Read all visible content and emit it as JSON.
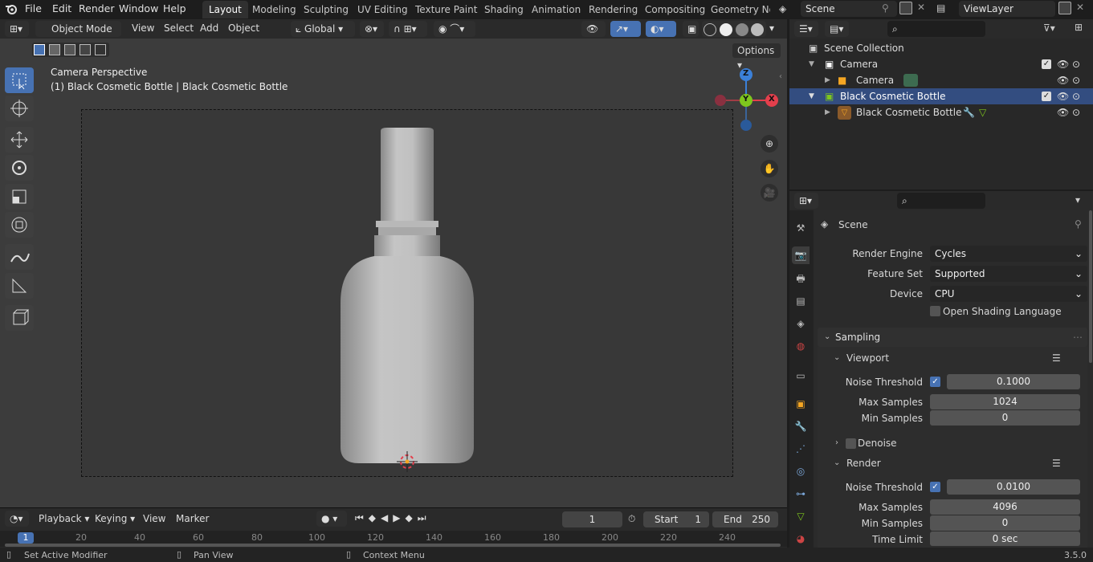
{
  "menus": [
    "File",
    "Edit",
    "Render",
    "Window",
    "Help"
  ],
  "workspaces": [
    "Layout",
    "Modeling",
    "Sculpting",
    "UV Editing",
    "Texture Paint",
    "Shading",
    "Animation",
    "Rendering",
    "Compositing",
    "Geometry Noc"
  ],
  "scene_field": "Scene",
  "viewlayer_field": "ViewLayer",
  "viewport_header": {
    "mode": "Object Mode",
    "menus": [
      "View",
      "Select",
      "Add",
      "Object"
    ],
    "orientation": "Global",
    "options": "Options"
  },
  "viewport": {
    "title": "Camera Perspective",
    "subtitle": "(1) Black Cosmetic Bottle | Black Cosmetic Bottle",
    "gizmo": {
      "z": "Z",
      "y": "Y",
      "x": "X"
    }
  },
  "timeline": {
    "menus": [
      "Playback",
      "Keying",
      "View",
      "Marker"
    ],
    "current_frame": "1",
    "start_label": "Start",
    "start_value": "1",
    "end_label": "End",
    "end_value": "250",
    "ruler": [
      "1",
      "20",
      "40",
      "60",
      "80",
      "100",
      "120",
      "140",
      "160",
      "180",
      "200",
      "220",
      "240"
    ]
  },
  "status": {
    "left": "Set Active Modifier",
    "middle": "Pan View",
    "right": "Context Menu",
    "version": "3.5.0"
  },
  "outliner": {
    "root": "Scene Collection",
    "rows": [
      {
        "label": "Camera",
        "type": "collection"
      },
      {
        "label": "Camera",
        "type": "object"
      },
      {
        "label": "Black Cosmetic Bottle",
        "type": "collection"
      },
      {
        "label": "Black Cosmetic Bottle",
        "type": "object"
      }
    ]
  },
  "properties": {
    "context": "Scene",
    "render_engine_label": "Render Engine",
    "render_engine": "Cycles",
    "feature_set_label": "Feature Set",
    "feature_set": "Supported",
    "device_label": "Device",
    "device": "CPU",
    "osl_label": "Open Shading Language",
    "sampling": "Sampling",
    "viewport_panel": "Viewport",
    "render_panel": "Render",
    "denoise_label": "Denoise",
    "vp_noise_label": "Noise Threshold",
    "vp_noise": "0.1000",
    "vp_max_label": "Max Samples",
    "vp_max": "1024",
    "vp_min_label": "Min Samples",
    "vp_min": "0",
    "r_noise_label": "Noise Threshold",
    "r_noise": "0.0100",
    "r_max_label": "Max Samples",
    "r_max": "4096",
    "r_min_label": "Min Samples",
    "r_min": "0",
    "r_time_label": "Time Limit",
    "r_time": "0 sec"
  },
  "colors": {
    "accent": "#4772b3",
    "selected_row": "#334d80",
    "x_axis": "#e33f4c",
    "y_axis": "#7ec61d",
    "z_axis": "#3b80d8"
  }
}
